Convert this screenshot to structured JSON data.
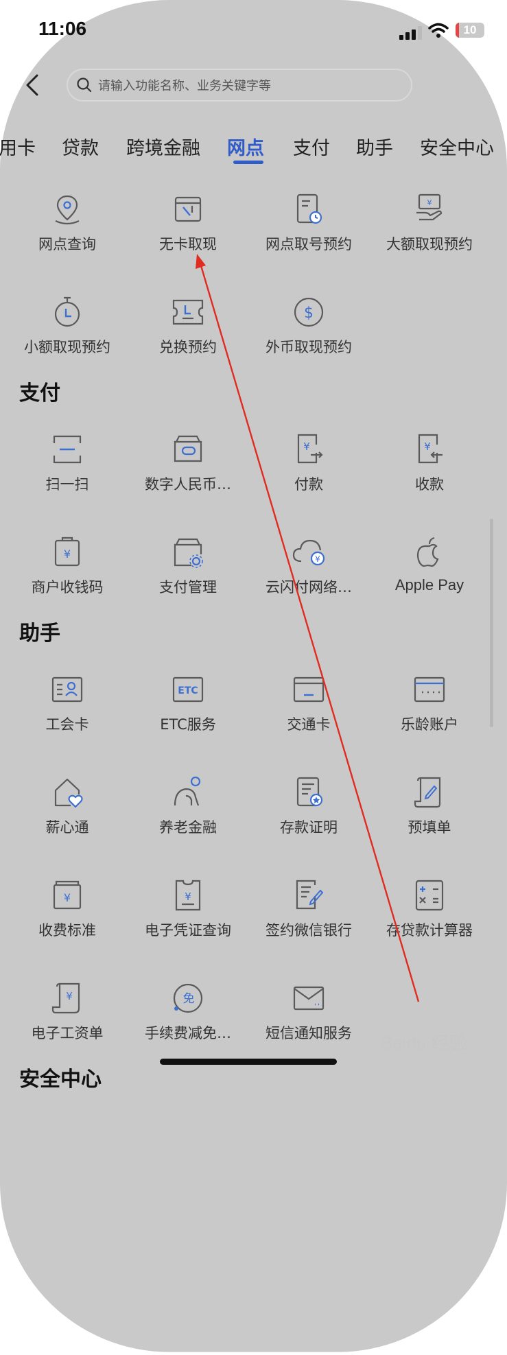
{
  "status_bar": {
    "time": "11:06",
    "battery": "10"
  },
  "search": {
    "placeholder": "请输入功能名称、业务关键字等"
  },
  "tabs": [
    "用卡",
    "贷款",
    "跨境金融",
    "网点",
    "支付",
    "助手",
    "安全中心"
  ],
  "active_tab": "网点",
  "sections": {
    "branch": {
      "items": [
        {
          "label": "网点查询",
          "icon": "location-pin-icon"
        },
        {
          "label": "无卡取现",
          "icon": "cardless-cash-icon"
        },
        {
          "label": "网点取号预约",
          "icon": "queue-ticket-icon"
        },
        {
          "label": "大额取现预约",
          "icon": "large-withdrawal-icon"
        },
        {
          "label": "小额取现预约",
          "icon": "stopwatch-icon"
        },
        {
          "label": "兑换预约",
          "icon": "exchange-ticket-icon"
        },
        {
          "label": "外币取现预约",
          "icon": "dollar-coin-icon"
        }
      ]
    },
    "payment": {
      "title": "支付",
      "items": [
        {
          "label": "扫一扫",
          "icon": "scan-icon"
        },
        {
          "label": "数字人民币…",
          "icon": "digital-wallet-icon"
        },
        {
          "label": "付款",
          "icon": "pay-icon"
        },
        {
          "label": "收款",
          "icon": "receive-icon"
        },
        {
          "label": "商户收钱码",
          "icon": "merchant-code-icon"
        },
        {
          "label": "支付管理",
          "icon": "payment-settings-icon"
        },
        {
          "label": "云闪付网络…",
          "icon": "cloud-pay-icon"
        },
        {
          "label": "Apple Pay",
          "icon": "apple-icon"
        }
      ]
    },
    "assistant": {
      "title": "助手",
      "items": [
        {
          "label": "工会卡",
          "icon": "union-card-icon"
        },
        {
          "label": "ETC服务",
          "icon": "etc-icon"
        },
        {
          "label": "交通卡",
          "icon": "transit-card-icon"
        },
        {
          "label": "乐龄账户",
          "icon": "senior-account-icon"
        },
        {
          "label": "薪心通",
          "icon": "home-heart-icon"
        },
        {
          "label": "养老金融",
          "icon": "pension-icon"
        },
        {
          "label": "存款证明",
          "icon": "deposit-certificate-icon"
        },
        {
          "label": "预填单",
          "icon": "prefill-form-icon"
        },
        {
          "label": "收费标准",
          "icon": "fee-standard-icon"
        },
        {
          "label": "电子凭证查询",
          "icon": "e-receipt-icon"
        },
        {
          "label": "签约微信银行",
          "icon": "sign-document-icon"
        },
        {
          "label": "存贷款计算器",
          "icon": "calculator-icon"
        },
        {
          "label": "电子工资单",
          "icon": "payslip-icon"
        },
        {
          "label": "手续费减免…",
          "icon": "fee-waiver-icon"
        },
        {
          "label": "短信通知服务",
          "icon": "sms-envelope-icon"
        }
      ]
    },
    "security": {
      "title": "安全中心"
    }
  },
  "watermark": "Baidu 经验",
  "colors": {
    "accent": "#2f5cc9",
    "icon_stroke": "#5a5a5a",
    "icon_accent": "#3d6fd1",
    "arrow": "#e02b20"
  }
}
